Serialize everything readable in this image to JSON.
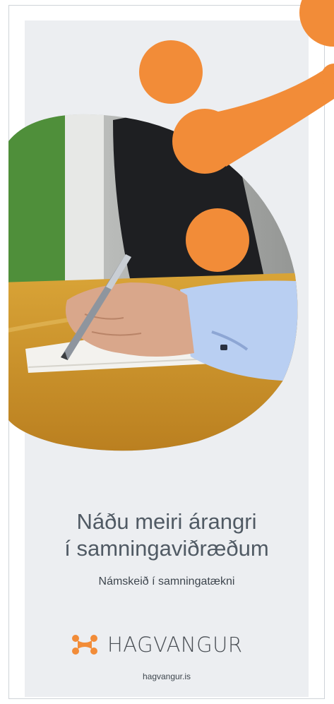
{
  "headline": {
    "line1": "Náðu meiri árangri",
    "line2": "í samningaviðræðum"
  },
  "subtitle": "Námskeið í samningatækni",
  "brand": {
    "name": "HAGVANGUR",
    "url": "hagvangur.is",
    "accent": "#f28c38"
  },
  "icons": [
    "hagvangur-logo-icon"
  ]
}
